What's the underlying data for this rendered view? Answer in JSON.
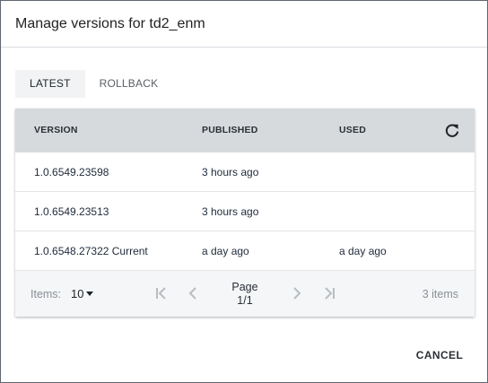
{
  "dialog": {
    "title": "Manage versions for td2_enm",
    "tabs": [
      {
        "label": "LATEST",
        "active": true
      },
      {
        "label": "ROLLBACK",
        "active": false
      }
    ],
    "table": {
      "columns": [
        "VERSION",
        "PUBLISHED",
        "USED"
      ],
      "refresh_icon": "refresh-icon",
      "rows": [
        {
          "version": "1.0.6549.23598",
          "published": "3 hours ago",
          "used": ""
        },
        {
          "version": "1.0.6549.23513",
          "published": "3 hours ago",
          "used": ""
        },
        {
          "version": "1.0.6548.27322 Current",
          "published": "a day ago",
          "used": "a day ago"
        }
      ]
    },
    "footer": {
      "items_label": "Items:",
      "items_per_page": "10",
      "page_label": "Page",
      "page_value": "1/1",
      "item_count": "3 items",
      "pager_icons": [
        "first-page-icon",
        "previous-page-icon",
        "next-page-icon",
        "last-page-icon"
      ]
    },
    "cancel_label": "CANCEL"
  },
  "colors": {
    "header_bg": "#d6dadd",
    "footer_bg": "#f4f6f8",
    "active_tab_bg": "#f1f3f5",
    "text_dark": "#1f2a3a",
    "text_muted": "#8a9096"
  }
}
